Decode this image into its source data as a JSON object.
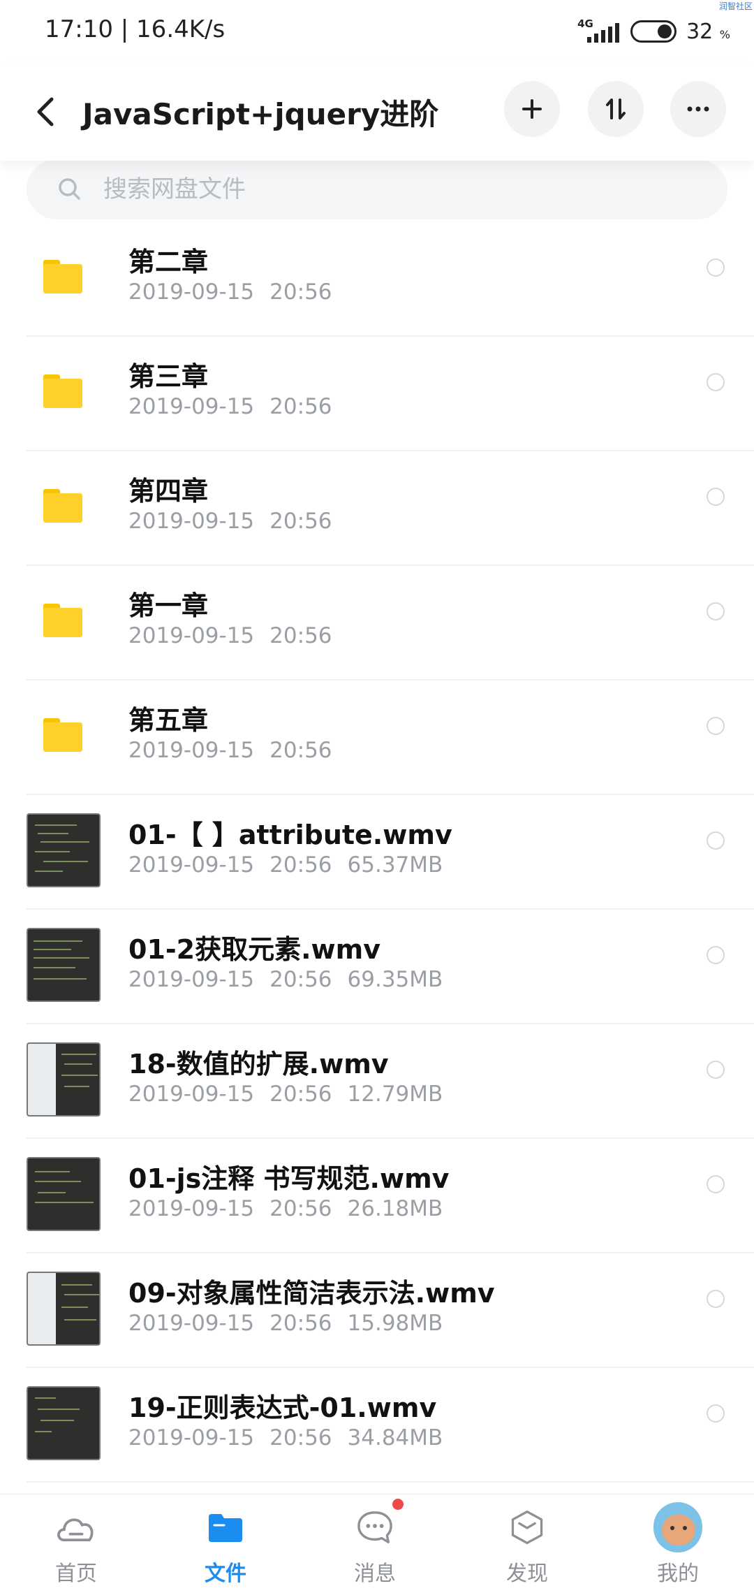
{
  "status_bar": {
    "time": "17:10 | 16.4K/s",
    "network": "4G",
    "battery": "32",
    "battery_unit": "%",
    "corner_text": "润智社区"
  },
  "header": {
    "title": "JavaScript+jquery进阶",
    "back_icon": "back-arrow-icon",
    "add_icon": "plus-icon",
    "sort_icon": "sort-icon",
    "more_icon": "more-dots-icon"
  },
  "search": {
    "placeholder": "搜索网盘文件"
  },
  "files": [
    {
      "name": "第二章",
      "date": "2019-09-15",
      "time": "20:56",
      "size": "",
      "type": "folder"
    },
    {
      "name": "第三章",
      "date": "2019-09-15",
      "time": "20:56",
      "size": "",
      "type": "folder"
    },
    {
      "name": "第四章",
      "date": "2019-09-15",
      "time": "20:56",
      "size": "",
      "type": "folder"
    },
    {
      "name": "第一章",
      "date": "2019-09-15",
      "time": "20:56",
      "size": "",
      "type": "folder"
    },
    {
      "name": "第五章",
      "date": "2019-09-15",
      "time": "20:56",
      "size": "",
      "type": "folder"
    },
    {
      "name": "01-【 】attribute.wmv",
      "date": "2019-09-15",
      "time": "20:56",
      "size": "65.37MB",
      "type": "video"
    },
    {
      "name": "01-2获取元素.wmv",
      "date": "2019-09-15",
      "time": "20:56",
      "size": "69.35MB",
      "type": "video"
    },
    {
      "name": "18-数值的扩展.wmv",
      "date": "2019-09-15",
      "time": "20:56",
      "size": "12.79MB",
      "type": "video"
    },
    {
      "name": "01-js注释 书写规范.wmv",
      "date": "2019-09-15",
      "time": "20:56",
      "size": "26.18MB",
      "type": "video"
    },
    {
      "name": "09-对象属性简洁表示法.wmv",
      "date": "2019-09-15",
      "time": "20:56",
      "size": "15.98MB",
      "type": "video"
    },
    {
      "name": "19-正则表达式-01.wmv",
      "date": "2019-09-15",
      "time": "20:56",
      "size": "34.84MB",
      "type": "video"
    }
  ],
  "bottom_nav": [
    {
      "label": "首页",
      "icon": "cloud-home-icon",
      "active": false
    },
    {
      "label": "文件",
      "icon": "folder-icon",
      "active": true
    },
    {
      "label": "消息",
      "icon": "chat-bubble-icon",
      "active": false
    },
    {
      "label": "发现",
      "icon": "box-icon",
      "active": false
    },
    {
      "label": "我的",
      "icon": "avatar-icon",
      "active": false
    }
  ],
  "colors": {
    "accent": "#1b8cf0",
    "folder": "#ffd02a",
    "badge": "#f04848"
  }
}
